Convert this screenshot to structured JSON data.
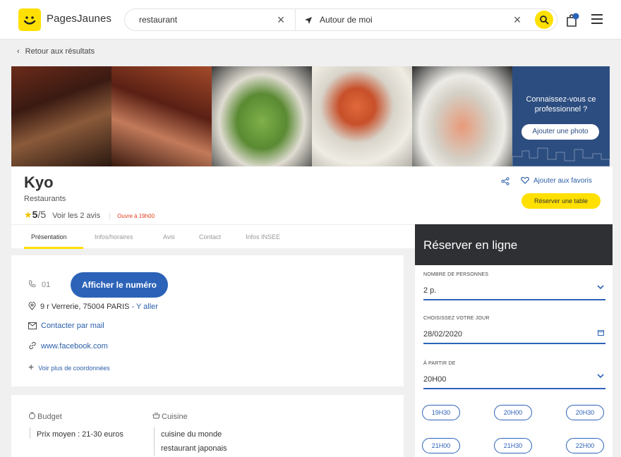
{
  "header": {
    "logo_text": "PagesJaunes",
    "search_what": "restaurant",
    "search_where": "Autour de moi"
  },
  "nav": {
    "back_label": "Retour aux résultats"
  },
  "photos": {
    "cta_text": "Connaissez-vous ce professionnel ?",
    "cta_button": "Ajouter une photo"
  },
  "business": {
    "name": "Kyo",
    "category": "Restaurants",
    "rating": "5",
    "rating_max": "/5",
    "reviews_link": "Voir les 2 avis",
    "open_status": "Ouvre à 19h00",
    "favorite_label": "Ajouter aux favoris",
    "reserve_label": "Réserver une table"
  },
  "tabs": [
    "Présentation",
    "Infos/horaires",
    "Avis",
    "Contact",
    "Infos INSEE"
  ],
  "contact": {
    "phone_prefix": "01",
    "show_number": "Afficher le numéro",
    "address": "9 r Verrerie, 75004 PARIS",
    "directions": "Y aller",
    "email": "Contacter par mail",
    "website": "www.facebook.com",
    "more": "Voir plus de coordonnées"
  },
  "details": {
    "budget_title": "Budget",
    "budget_value": "Prix moyen : 21-30 euros",
    "cuisine_title": "Cuisine",
    "cuisine_values": [
      "cuisine du monde",
      "restaurant japonais"
    ]
  },
  "booking": {
    "title": "Réserver en ligne",
    "persons_label": "NOMBRE DE PERSONNES",
    "persons_value": "2 p.",
    "day_label": "CHOISISSEZ VOTRE JOUR",
    "day_value": "28/02/2020",
    "time_label": "À PARTIR DE",
    "time_value": "20H00",
    "slots": [
      "19H30",
      "20H00",
      "20H30",
      "21H00",
      "21H30",
      "22H00"
    ]
  },
  "colors": {
    "brand_yellow": "#ffe000",
    "primary_blue": "#2c63b8",
    "dark_header": "#2e3033",
    "open_red": "#e23c1a"
  }
}
